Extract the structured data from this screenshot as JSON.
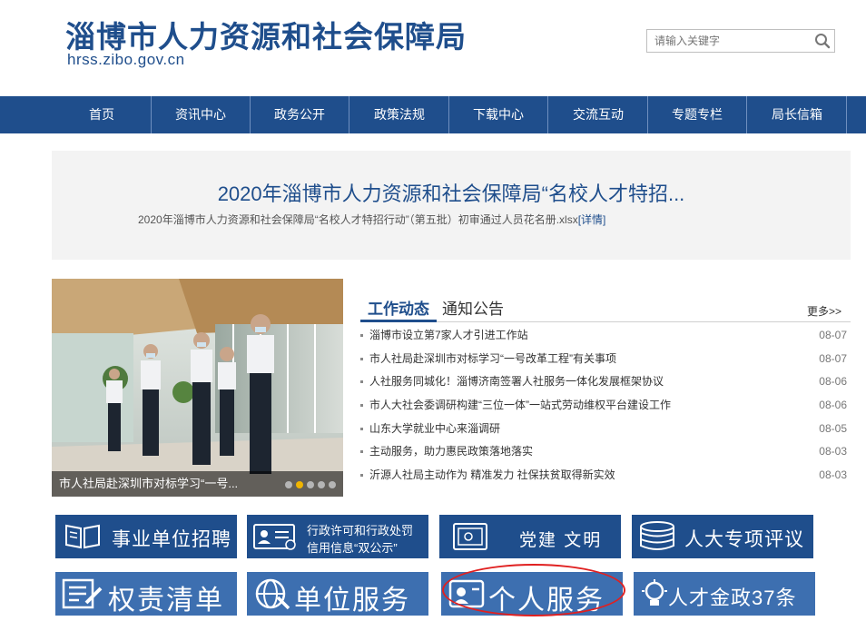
{
  "header": {
    "title": "淄博市人力资源和社会保障局",
    "domain": "hrss.zibo.gov.cn",
    "search_placeholder": "请输入关键字"
  },
  "nav": {
    "items": [
      "首页",
      "资讯中心",
      "政务公开",
      "政策法规",
      "下载中心",
      "交流互动",
      "专题专栏",
      "局长信箱"
    ]
  },
  "banner": {
    "title": "2020年淄博市人力资源和社会保障局“名校人才特招...",
    "subtitle": "2020年淄博市人力资源和社会保障局“名校人才特招行动”（第五批）初审通过人员花名册.xlsx",
    "detail": "[详情]"
  },
  "slider": {
    "caption": "市人社局赴深圳市对标学习“一号...",
    "dots": 5,
    "active_dot": 1
  },
  "news": {
    "tabs": [
      "工作动态",
      "通知公告"
    ],
    "more": "更多>>",
    "items": [
      {
        "title": "淄博市设立第7家人才引进工作站",
        "date": "08-07"
      },
      {
        "title": "市人社局赴深圳市对标学习“一号改革工程”有关事项",
        "date": "08-07"
      },
      {
        "title": "人社服务同城化！淄博济南签署人社服务一体化发展框架协议",
        "date": "08-06"
      },
      {
        "title": "市人大社会委调研构建“三位一体”一站式劳动维权平台建设工作",
        "date": "08-06"
      },
      {
        "title": "山东大学就业中心来淄调研",
        "date": "08-05"
      },
      {
        "title": "主动服务，助力惠民政策落地落实",
        "date": "08-03"
      },
      {
        "title": "沂源人社局主动作为 精准发力 社保扶贫取得新实效",
        "date": "08-03"
      }
    ]
  },
  "tiles": {
    "row1": [
      {
        "label": "事业单位招聘",
        "icon": "book-icon"
      },
      {
        "label": "行政许可和行政处罚",
        "label2": "信用信息“双公示”",
        "icon": "id-card-icon"
      },
      {
        "label": "党建 文明",
        "icon": "safe-icon"
      },
      {
        "label": "人大专项评议",
        "icon": "database-icon"
      }
    ],
    "row2": [
      {
        "label": "权责清单",
        "icon": "checklist-icon"
      },
      {
        "label": "单位服务",
        "icon": "globe-icon"
      },
      {
        "label": "个人服务",
        "icon": "person-card-icon"
      },
      {
        "label": "人才金政37条",
        "icon": "lightbulb-icon"
      }
    ]
  },
  "colors": {
    "brand": "#1f4e8c",
    "annotation": "#e02020",
    "dot_active": "#f0b400"
  }
}
